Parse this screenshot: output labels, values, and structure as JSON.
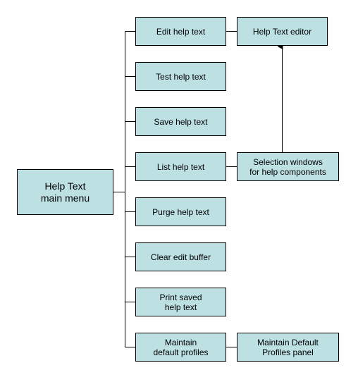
{
  "colors": {
    "box_fill": "#bde0e3",
    "line": "#000000"
  },
  "root": {
    "label": "Help Text\nmain menu"
  },
  "menu_items": [
    {
      "label": "Edit help text"
    },
    {
      "label": "Test help text"
    },
    {
      "label": "Save help text"
    },
    {
      "label": "List help text"
    },
    {
      "label": "Purge help text"
    },
    {
      "label": "Clear edit buffer"
    },
    {
      "label": "Print saved\nhelp text"
    },
    {
      "label": "Maintain\ndefault profiles"
    }
  ],
  "secondary": {
    "editor": {
      "label": "Help Text editor"
    },
    "selection": {
      "label": "Selection windows\nfor help components"
    },
    "profiles": {
      "label": "Maintain Default\nProfiles panel"
    }
  }
}
